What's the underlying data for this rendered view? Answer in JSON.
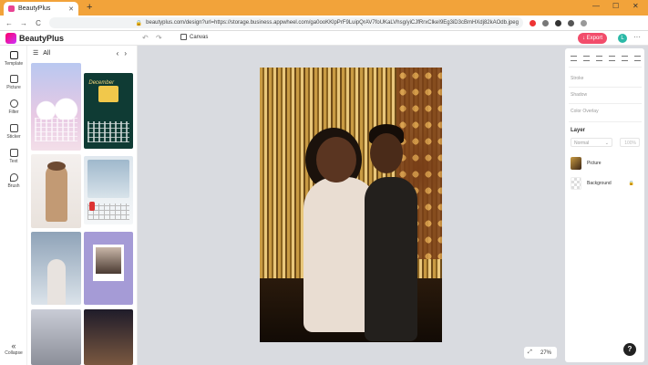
{
  "browser": {
    "tab_title": "BeautyPlus",
    "tab_close": "✕",
    "new_tab": "+",
    "url": "beautyplus.com/design?url=https://storage.business.appwheel.com/ga0ooKKlpPrF9LuipQrAV7foUKaLVhsg/yiCJfRrxClkeI9Eg3iD3cBmHXdj82kAOdb.jpeg",
    "lock_icon": "🔒",
    "back": "←",
    "forward": "→",
    "reload": "C",
    "win_min": "—",
    "win_max": "☐",
    "win_close": "✕"
  },
  "header": {
    "brand": "BeautyPlus",
    "undo": "↶",
    "redo": "↷",
    "canvas_label": "Canvas",
    "export_label": "↓ Export",
    "avatar_initial": "L",
    "more": "···"
  },
  "rail": {
    "items": [
      {
        "label": "Template"
      },
      {
        "label": "Picture"
      },
      {
        "label": "Filter"
      },
      {
        "label": "Sticker"
      },
      {
        "label": "Text"
      },
      {
        "label": "Brush"
      }
    ],
    "collapse_icon": "«",
    "collapse_label": "Collapse"
  },
  "panel": {
    "menu_icon": "☰",
    "category": "All",
    "prev": "‹",
    "next": "›",
    "thumb_title": "December"
  },
  "canvas": {
    "zoom": "27%",
    "fit_icon": "⤢"
  },
  "props": {
    "stroke": "Stroke",
    "shadow": "Shadow",
    "color_overlay": "Color Overlay",
    "layer_title": "Layer",
    "blend_mode": "Normal",
    "blend_chevron": "⌄",
    "opacity": "100%",
    "layers": [
      {
        "name": "Picture"
      },
      {
        "name": "Background"
      }
    ],
    "lock_icon": "🔒"
  },
  "help": "?",
  "colors": {
    "browser_bar": "#f2a33a",
    "export": "#f24d6b",
    "avatar": "#2bb9a7"
  }
}
